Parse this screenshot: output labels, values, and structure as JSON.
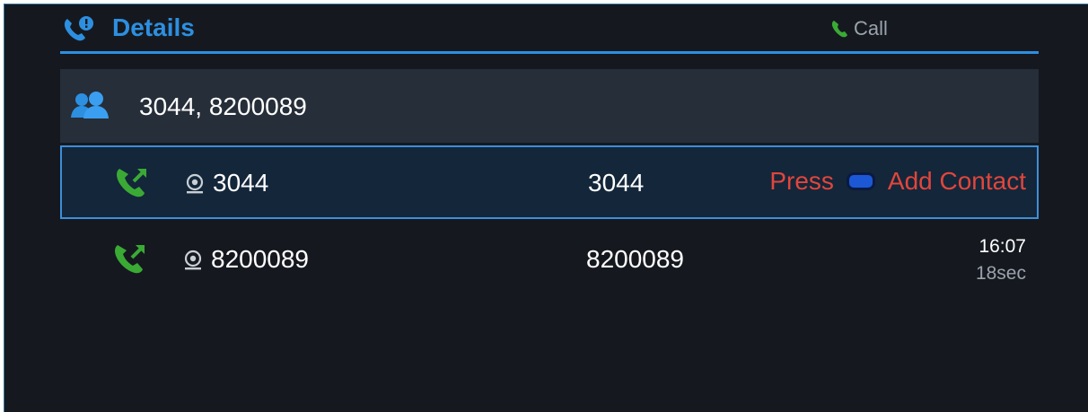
{
  "header": {
    "title": "Details",
    "call_label": "Call",
    "icon": "phone-info-icon",
    "accent_color": "#2d8fe0"
  },
  "group": {
    "icon": "contacts-group-icon",
    "participants": "3044, 8200089"
  },
  "calls": [
    {
      "icon": "outgoing-call-icon",
      "account_icon": "account-icon",
      "name": "3044",
      "number": "3044",
      "selected": true,
      "hint_press": "Press",
      "hint_action": "Add Contact",
      "key_icon": "blue-key-icon"
    },
    {
      "icon": "outgoing-call-icon",
      "account_icon": "account-icon",
      "name": "8200089",
      "number": "8200089",
      "selected": false,
      "time": "16:07",
      "duration": "18sec"
    }
  ],
  "colors": {
    "background": "#15191f",
    "selection_border": "#3d8fd8",
    "call_icon_green": "#3aaa35",
    "hint_red": "#e0463c"
  }
}
